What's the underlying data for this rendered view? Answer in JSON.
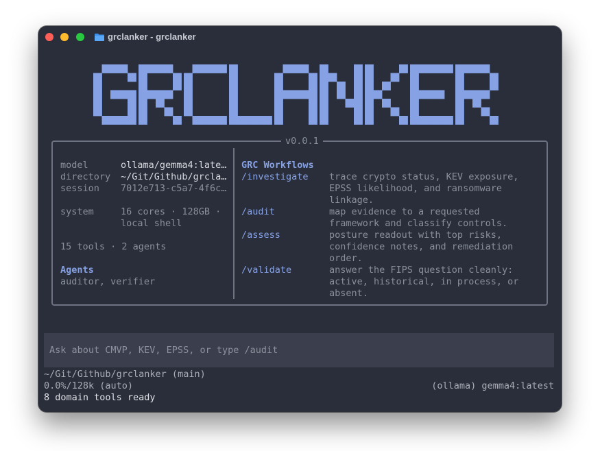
{
  "window": {
    "title": "grclanker - grclanker"
  },
  "logo": {
    "text": "GRCLANKER",
    "color": "#86a2e4"
  },
  "version": "v0.0.1",
  "info": {
    "model_label": "model",
    "model_value": "ollama/gemma4:late…",
    "directory_label": "directory",
    "directory_value": "~/Git/Github/grcla…",
    "session_label": "session",
    "session_value": "7012e713-c5a7-4f6c…",
    "system_label": "system",
    "system_value_1": "16 cores · 128GB ·",
    "system_value_2": "local shell",
    "tools_summary": "15 tools · 2 agents",
    "agents_heading": "Agents",
    "agents_list": "auditor, verifier"
  },
  "workflows": {
    "heading": "GRC Workflows",
    "items": [
      {
        "command": "/investigate",
        "desc": [
          "trace crypto status, KEV exposure,",
          "EPSS likelihood, and ransomware",
          "linkage."
        ]
      },
      {
        "command": "/audit",
        "desc": [
          "map evidence to a requested",
          "framework and classify controls."
        ]
      },
      {
        "command": "/assess",
        "desc": [
          "posture readout with top risks,",
          "confidence notes, and remediation",
          "order."
        ]
      },
      {
        "command": "/validate",
        "desc": [
          "answer the FIPS question cleanly:",
          "active, historical, in process, or",
          "absent."
        ]
      }
    ]
  },
  "input": {
    "placeholder": "Ask about CMVP, KEV, EPSS, or type /audit"
  },
  "statusbar": {
    "path": "~/Git/Github/grclanker (main)",
    "context": "0.0%/128k (auto)",
    "model": "(ollama) gemma4:latest",
    "tools_ready": "8 domain tools ready"
  }
}
